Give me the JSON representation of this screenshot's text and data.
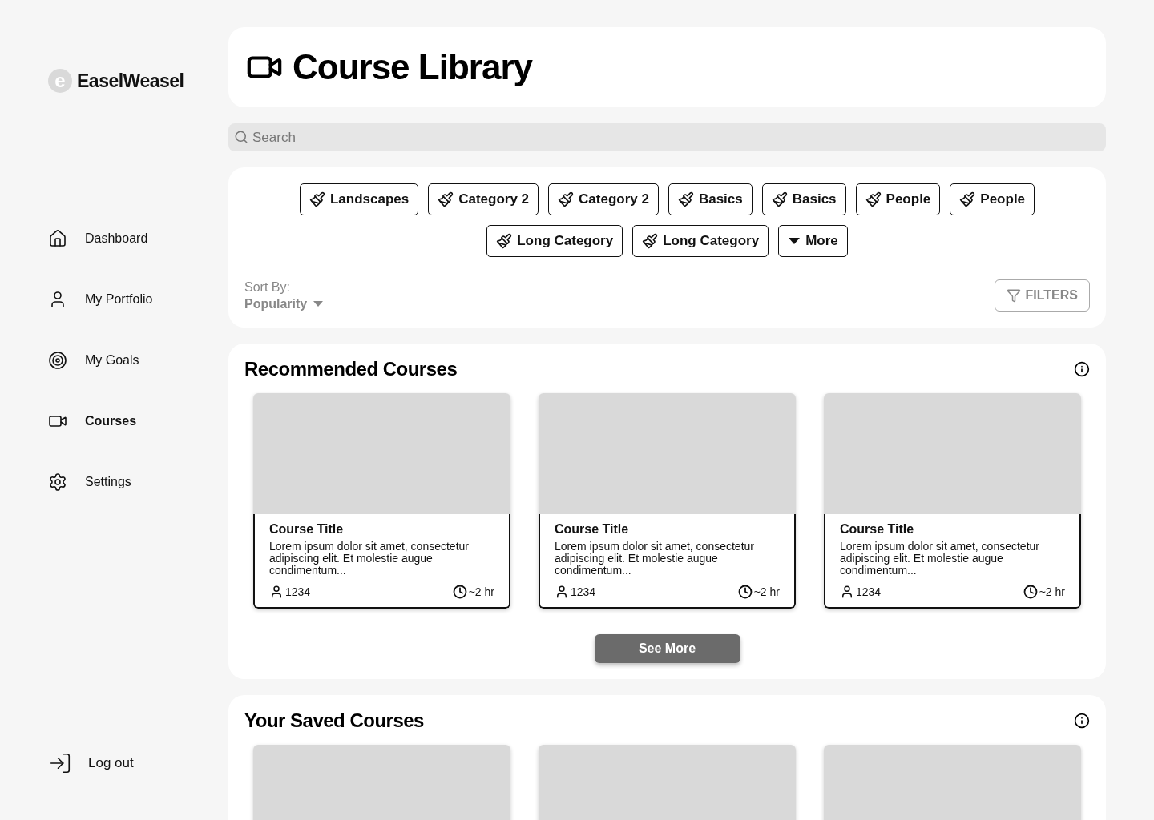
{
  "brand": {
    "logo_letter": "e",
    "name": "EaselWeasel"
  },
  "nav": [
    {
      "label": "Dashboard",
      "selected": false
    },
    {
      "label": "My Portfolio",
      "selected": false
    },
    {
      "label": "My Goals",
      "selected": false
    },
    {
      "label": "Courses",
      "selected": true
    },
    {
      "label": "Settings",
      "selected": false
    }
  ],
  "logout": {
    "label": "Log out"
  },
  "header": {
    "title": "Course Library"
  },
  "search": {
    "placeholder": "Search"
  },
  "categories": [
    {
      "label": "Landscapes",
      "kind": "category"
    },
    {
      "label": "Category 2",
      "kind": "category"
    },
    {
      "label": "Category 2",
      "kind": "category"
    },
    {
      "label": "Basics",
      "kind": "category"
    },
    {
      "label": "Basics",
      "kind": "category"
    },
    {
      "label": "People",
      "kind": "category"
    },
    {
      "label": "People",
      "kind": "category"
    },
    {
      "label": "Long Category",
      "kind": "category"
    },
    {
      "label": "Long Category",
      "kind": "category"
    },
    {
      "label": "More",
      "kind": "more"
    }
  ],
  "sort": {
    "label": "Sort By:",
    "value": "Popularity"
  },
  "filters_button": "FILTERS",
  "recommended": {
    "title": "Recommended Courses",
    "courses": [
      {
        "title": "Course Title",
        "description": "Lorem ipsum dolor sit amet, consectetur adipiscing elit. Et molestie augue condimentum...",
        "students": "1234",
        "duration": "~2 hr"
      },
      {
        "title": "Course Title",
        "description": "Lorem ipsum dolor sit amet, consectetur adipiscing elit. Et molestie augue condimentum...",
        "students": "1234",
        "duration": "~2 hr"
      },
      {
        "title": "Course Title",
        "description": "Lorem ipsum dolor sit amet, consectetur adipiscing elit. Et molestie augue condimentum...",
        "students": "1234",
        "duration": "~2 hr"
      }
    ],
    "see_more": "See More"
  },
  "saved": {
    "title": "Your Saved Courses",
    "courses": [
      {
        "kind": "placeholder"
      },
      {
        "kind": "placeholder"
      },
      {
        "kind": "placeholder"
      }
    ]
  }
}
